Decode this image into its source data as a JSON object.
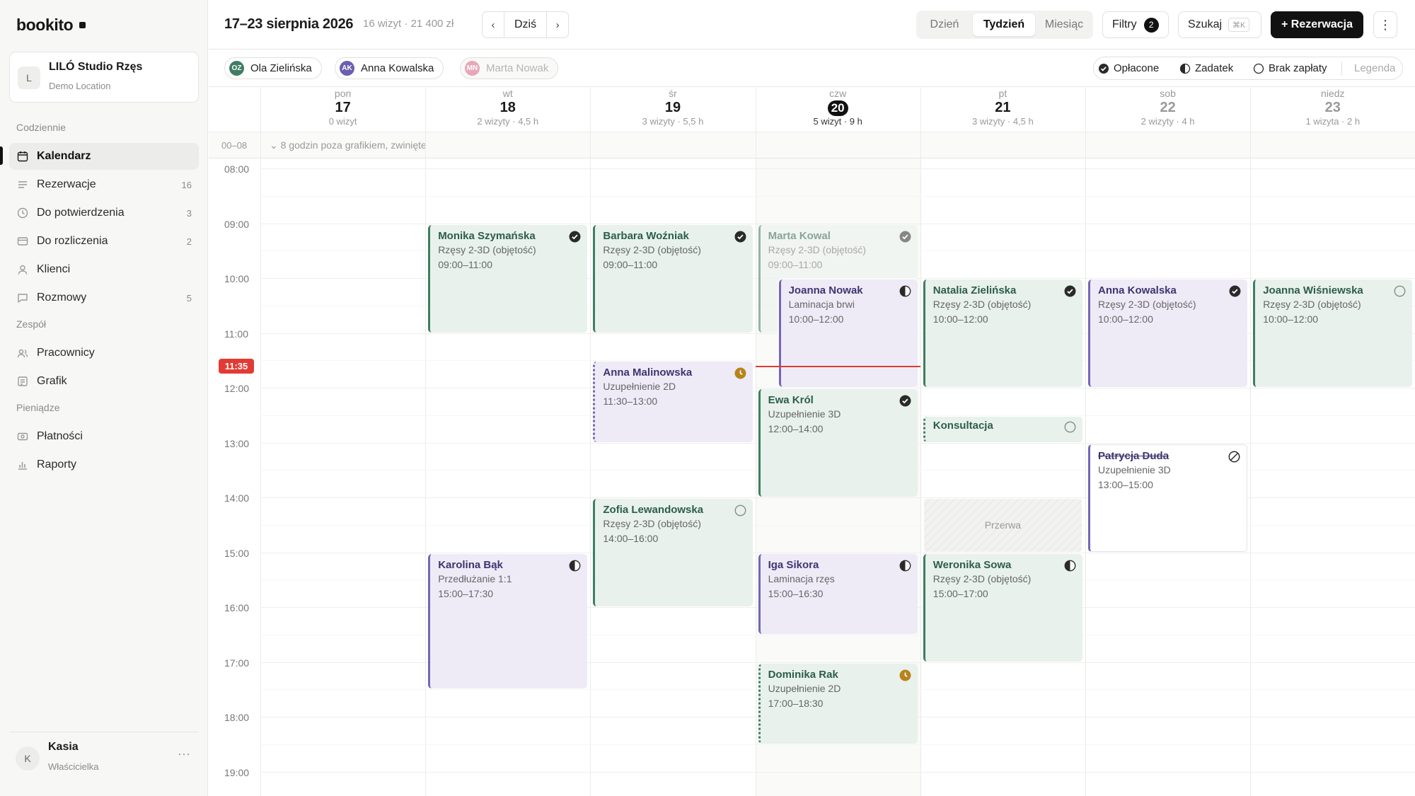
{
  "app": {
    "logo": "bookito"
  },
  "studio": {
    "initial": "L",
    "name": "LILÓ Studio Rzęs",
    "location": "Demo Location"
  },
  "sidebar": {
    "sections": [
      {
        "title": "Codziennie",
        "items": [
          {
            "label": "Kalendarz",
            "icon": "calendar-icon",
            "count": "",
            "active": true
          },
          {
            "label": "Rezerwacje",
            "icon": "list-icon",
            "count": "16"
          },
          {
            "label": "Do potwierdzenia",
            "icon": "clock-icon",
            "count": "3"
          },
          {
            "label": "Do rozliczenia",
            "icon": "card-icon",
            "count": "2"
          },
          {
            "label": "Klienci",
            "icon": "person-icon",
            "count": ""
          },
          {
            "label": "Rozmowy",
            "icon": "chat-icon",
            "count": "5"
          }
        ]
      },
      {
        "title": "Zespół",
        "items": [
          {
            "label": "Pracownicy",
            "icon": "team-icon",
            "count": ""
          },
          {
            "label": "Grafik",
            "icon": "schedule-icon",
            "count": ""
          }
        ]
      },
      {
        "title": "Pieniądze",
        "items": [
          {
            "label": "Płatności",
            "icon": "money-icon",
            "count": ""
          },
          {
            "label": "Raporty",
            "icon": "chart-icon",
            "count": ""
          }
        ]
      }
    ]
  },
  "user": {
    "initial": "K",
    "name": "Kasia",
    "role": "Właścicielka"
  },
  "header": {
    "title": "17–23 sierpnia 2026",
    "subtitle": "16 wizyt · 21 400 zł",
    "prev": "‹",
    "today": "Dziś",
    "next": "›",
    "views": [
      "Dzień",
      "Tydzień",
      "Miesiąc"
    ],
    "selected_view": "Tydzień",
    "filters_label": "Filtry",
    "filters_count": "2",
    "search_label": "Szukaj",
    "search_shortcut": "⌘K",
    "new_button": "+ Rezerwacja",
    "more": "⋮"
  },
  "staff": [
    {
      "initials": "OZ",
      "name": "Ola Zielińska",
      "color": "#3f7e64",
      "active": true
    },
    {
      "initials": "AK",
      "name": "Anna Kowalska",
      "color": "#6b5fb0",
      "active": true
    },
    {
      "initials": "MN",
      "name": "Marta Nowak",
      "color": "#e8a7b8",
      "active": false
    }
  ],
  "legend": {
    "paid": "Opłacone",
    "deposit": "Zadatek",
    "unpaid": "Brak zapłaty",
    "label": "Legenda"
  },
  "days": [
    {
      "name": "pon",
      "num": "17",
      "summary": "0 wizyt"
    },
    {
      "name": "wt",
      "num": "18",
      "summary": "2 wizyty · 4,5 h"
    },
    {
      "name": "śr",
      "num": "19",
      "summary": "3 wizyty · 5,5 h"
    },
    {
      "name": "czw",
      "num": "20",
      "summary": "5 wizyt · 9 h",
      "today": true
    },
    {
      "name": "pt",
      "num": "21",
      "summary": "3 wizyty · 4,5 h"
    },
    {
      "name": "sob",
      "num": "22",
      "summary": "2 wizyty · 4 h",
      "dim": true
    },
    {
      "name": "niedz",
      "num": "23",
      "summary": "1 wizyta · 2 h",
      "dim": true
    }
  ],
  "collapsed": {
    "range": "00–08",
    "message": "⌄ 8 godzin poza grafikiem, zwinięte"
  },
  "hours": [
    "08:00",
    "09:00",
    "10:00",
    "11:00",
    "12:00",
    "13:00",
    "14:00",
    "15:00",
    "16:00",
    "17:00",
    "18:00",
    "19:00"
  ],
  "now": {
    "label": "11:35",
    "time": 11.583
  },
  "events": [
    {
      "day": 1,
      "start": 9,
      "end": 11,
      "name": "Monika Szymańska",
      "service": "Rzęsy 2-3D (objętość)",
      "time": "09:00–11:00",
      "style": "green",
      "status": "paid"
    },
    {
      "day": 1,
      "start": 15,
      "end": 17.5,
      "name": "Karolina Bąk",
      "service": "Przedłużanie 1:1",
      "time": "15:00–17:30",
      "style": "purple",
      "status": "deposit"
    },
    {
      "day": 2,
      "start": 9,
      "end": 11,
      "name": "Barbara Woźniak",
      "service": "Rzęsy 2-3D (objętość)",
      "time": "09:00–11:00",
      "style": "green",
      "status": "paid"
    },
    {
      "day": 2,
      "start": 11.5,
      "end": 13,
      "name": "Anna Malinowska",
      "service": "Uzupełnienie 2D",
      "time": "11:30–13:00",
      "style": "purple",
      "status": "pending",
      "dotted": true
    },
    {
      "day": 2,
      "start": 14,
      "end": 16,
      "name": "Zofia Lewandowska",
      "service": "Rzęsy 2-3D (objętość)",
      "time": "14:00–16:00",
      "style": "green",
      "status": "unpaid"
    },
    {
      "day": 3,
      "start": 9,
      "end": 11,
      "name": "Marta Kowal",
      "service": "Rzęsy 2-3D (objętość)",
      "time": "09:00–11:00",
      "style": "green",
      "status": "paid",
      "faded": true
    },
    {
      "day": 3,
      "start": 10,
      "end": 12,
      "name": "Joanna Nowak",
      "service": "Laminacja brwi",
      "time": "10:00–12:00",
      "style": "purple",
      "status": "deposit",
      "overlap": true
    },
    {
      "day": 3,
      "start": 12,
      "end": 14,
      "name": "Ewa Król",
      "service": "Uzupełnienie 3D",
      "time": "12:00–14:00",
      "style": "green",
      "status": "paid"
    },
    {
      "day": 3,
      "start": 15,
      "end": 16.5,
      "name": "Iga Sikora",
      "service": "Laminacja rzęs",
      "time": "15:00–16:30",
      "style": "purple",
      "status": "deposit"
    },
    {
      "day": 3,
      "start": 17,
      "end": 18.5,
      "name": "Dominika Rak",
      "service": "Uzupełnienie 2D",
      "time": "17:00–18:30",
      "style": "green",
      "status": "pending",
      "dotted": true
    },
    {
      "day": 4,
      "start": 10,
      "end": 12,
      "name": "Natalia Zielińska",
      "service": "Rzęsy 2-3D (objętość)",
      "time": "10:00–12:00",
      "style": "green",
      "status": "paid"
    },
    {
      "day": 4,
      "start": 12.5,
      "end": 13,
      "name": "Konsultacja",
      "service": "",
      "time": "",
      "style": "green",
      "status": "unpaid",
      "dotted": true
    },
    {
      "day": 4,
      "start": 15,
      "end": 17,
      "name": "Weronika Sowa",
      "service": "Rzęsy 2-3D (objętość)",
      "time": "15:00–17:00",
      "style": "green",
      "status": "deposit"
    },
    {
      "day": 5,
      "start": 10,
      "end": 12,
      "name": "Anna Kowalska",
      "service": "Rzęsy 2-3D (objętość)",
      "time": "10:00–12:00",
      "style": "purple",
      "status": "paid"
    },
    {
      "day": 5,
      "start": 13,
      "end": 15,
      "name": "Patrycja Duda",
      "service": "Uzupełnienie 3D",
      "time": "13:00–15:00",
      "style": "white",
      "status": "cancelled",
      "strike": true
    },
    {
      "day": 6,
      "start": 10,
      "end": 12,
      "name": "Joanna Wiśniewska",
      "service": "Rzęsy 2-3D (objętość)",
      "time": "10:00–12:00",
      "style": "green",
      "status": "unpaid"
    }
  ],
  "breaks": [
    {
      "day": 4,
      "start": 14,
      "end": 15,
      "label": "Przerwa"
    }
  ]
}
